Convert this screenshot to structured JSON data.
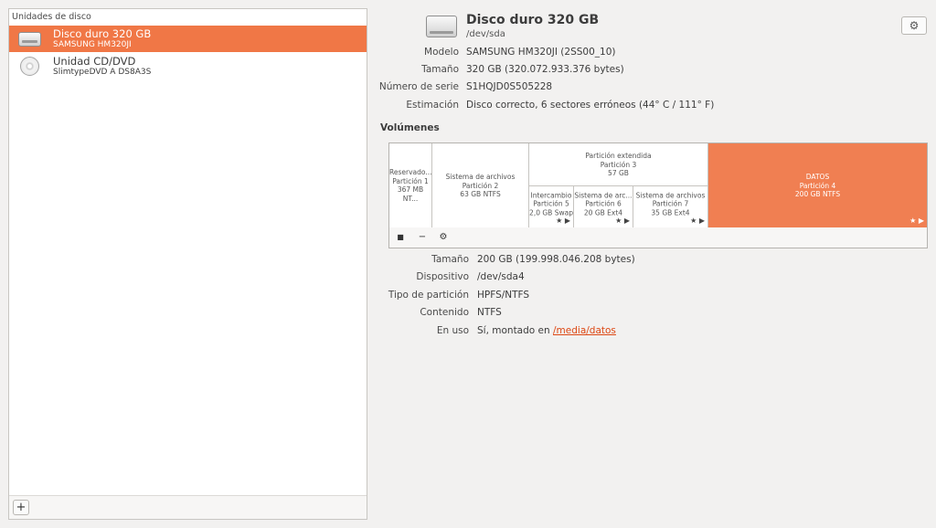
{
  "sidebar": {
    "header": "Unidades de disco",
    "drives": [
      {
        "name": "Disco duro 320 GB",
        "sub": "SAMSUNG HM320JI",
        "icon": "hdd-icon",
        "selected": true
      },
      {
        "name": "Unidad CD/DVD",
        "sub": "SlimtypeDVD A DS8A3S",
        "icon": "cd-icon",
        "selected": false
      }
    ],
    "add_label": "+"
  },
  "disk": {
    "title": "Disco duro 320 GB",
    "device": "/dev/sda",
    "gear_icon": "⚙",
    "props": [
      {
        "label": "Modelo",
        "value": "SAMSUNG HM320JI (2SS00_10)"
      },
      {
        "label": "Tamaño",
        "value": "320 GB (320.072.933.376 bytes)"
      },
      {
        "label": "Número de serie",
        "value": "S1HQJD0S505228"
      },
      {
        "label": "Estimación",
        "value": "Disco correcto, 6 sectores erróneos (44° C / 111° F)"
      }
    ]
  },
  "volumes": {
    "title": "Volúmenes",
    "partitions": {
      "p1": {
        "l1": "Reservado...",
        "l2": "Partición 1",
        "l3": "367 MB NT..."
      },
      "p2": {
        "l1": "Sistema de archivos",
        "l2": "Partición 2",
        "l3": "63 GB NTFS"
      },
      "ext": {
        "l1": "Partición extendida",
        "l2": "Partición 3",
        "l3": "57 GB"
      },
      "p5": {
        "l1": "Intercambio",
        "l2": "Partición 5",
        "l3": "2,0 GB Swap",
        "marks": "★ ▶"
      },
      "p6": {
        "l1": "Sistema de arc...",
        "l2": "Partición 6",
        "l3": "20 GB Ext4",
        "marks": "★ ▶"
      },
      "p7": {
        "l1": "Sistema de archivos",
        "l2": "Partición 7",
        "l3": "35 GB Ext4",
        "marks": "★ ▶"
      },
      "p4": {
        "l1": "DATOS",
        "l2": "Partición 4",
        "l3": "200 GB NTFS",
        "marks": "★ ▶"
      }
    },
    "toolbar": {
      "stop": "■",
      "minus": "−",
      "gears": "⚙"
    },
    "accent": "#f07746"
  },
  "volume_props": [
    {
      "label": "Tamaño",
      "value": "200 GB (199.998.046.208 bytes)"
    },
    {
      "label": "Dispositivo",
      "value": "/dev/sda4"
    },
    {
      "label": "Tipo de partición",
      "value": "HPFS/NTFS"
    },
    {
      "label": "Contenido",
      "value": "NTFS"
    },
    {
      "label": "En uso",
      "value": "Sí, montado en",
      "link": "/media/datos"
    }
  ]
}
